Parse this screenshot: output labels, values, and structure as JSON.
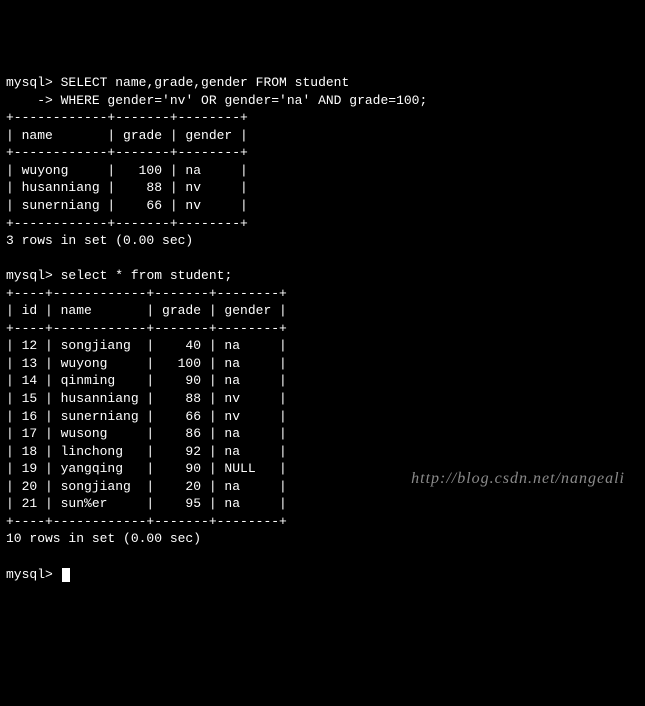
{
  "query1": {
    "prompt": "mysql>",
    "continuation": "    ->",
    "line1": "SELECT name,grade,gender FROM student",
    "line2": "WHERE gender='nv' OR gender='na' AND grade=100;",
    "border_top": "+------------+-------+--------+",
    "header_row": "| name       | grade | gender |",
    "border_mid": "+------------+-------+--------+",
    "rows": [
      "| wuyong     |   100 | na     |",
      "| husanniang |    88 | nv     |",
      "| sunerniang |    66 | nv     |"
    ],
    "border_bot": "+------------+-------+--------+",
    "status": "3 rows in set (0.00 sec)"
  },
  "query2": {
    "prompt": "mysql>",
    "line1": "select * from student;",
    "border_top": "+----+------------+-------+--------+",
    "header_row": "| id | name       | grade | gender |",
    "border_mid": "+----+------------+-------+--------+",
    "rows": [
      "| 12 | songjiang  |    40 | na     |",
      "| 13 | wuyong     |   100 | na     |",
      "| 14 | qinming    |    90 | na     |",
      "| 15 | husanniang |    88 | nv     |",
      "| 16 | sunerniang |    66 | nv     |",
      "| 17 | wusong     |    86 | na     |",
      "| 18 | linchong   |    92 | na     |",
      "| 19 | yangqing   |    90 | NULL   |",
      "| 20 | songjiang  |    20 | na     |",
      "| 21 | sun%er     |    95 | na     |"
    ],
    "border_bot": "+----+------------+-------+--------+",
    "status": "10 rows in set (0.00 sec)"
  },
  "final_prompt": "mysql>",
  "watermark": "http://blog.csdn.net/nangeali",
  "chart_data": {
    "type": "table",
    "tables": [
      {
        "title": "Result of SELECT name,grade,gender FROM student WHERE gender='nv' OR gender='na' AND grade=100",
        "columns": [
          "name",
          "grade",
          "gender"
        ],
        "rows": [
          [
            "wuyong",
            100,
            "na"
          ],
          [
            "husanniang",
            88,
            "nv"
          ],
          [
            "sunerniang",
            66,
            "nv"
          ]
        ],
        "row_count": 3,
        "elapsed_sec": 0.0
      },
      {
        "title": "Result of select * from student",
        "columns": [
          "id",
          "name",
          "grade",
          "gender"
        ],
        "rows": [
          [
            12,
            "songjiang",
            40,
            "na"
          ],
          [
            13,
            "wuyong",
            100,
            "na"
          ],
          [
            14,
            "qinming",
            90,
            "na"
          ],
          [
            15,
            "husanniang",
            88,
            "nv"
          ],
          [
            16,
            "sunerniang",
            66,
            "nv"
          ],
          [
            17,
            "wusong",
            86,
            "na"
          ],
          [
            18,
            "linchong",
            92,
            "na"
          ],
          [
            19,
            "yangqing",
            90,
            null
          ],
          [
            20,
            "songjiang",
            20,
            "na"
          ],
          [
            21,
            "sun%er",
            95,
            "na"
          ]
        ],
        "row_count": 10,
        "elapsed_sec": 0.0
      }
    ]
  }
}
